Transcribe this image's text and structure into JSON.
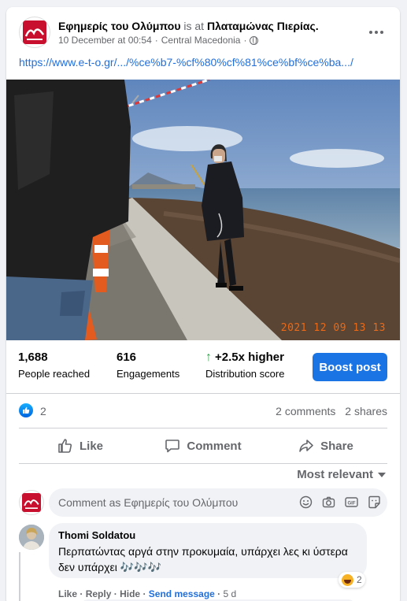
{
  "post": {
    "page_name": "Εφημερίς του Ολύμπου",
    "is_at": "is at",
    "location": "Πλαταμώνας Πιερίας.",
    "timestamp": "10 December at 00:54",
    "separator": "·",
    "region": "Central Macedonia",
    "privacy_icon": "globe-icon",
    "link": "https://www.e-t-o.gr/.../%ce%b7-%cf%80%cf%81%ce%bf%ce%ba.../",
    "photo_stamp": "2021 12 09 13 13"
  },
  "insights": {
    "reached_value": "1,688",
    "reached_label": "People reached",
    "engagements_value": "616",
    "engagements_label": "Engagements",
    "distribution_value": "+2.5x higher",
    "distribution_label": "Distribution score",
    "boost_label": "Boost post"
  },
  "reactions": {
    "count": "2",
    "comments": "2 comments",
    "shares": "2 shares"
  },
  "actions": {
    "like": "Like",
    "comment": "Comment",
    "share": "Share"
  },
  "sort": {
    "label": "Most relevant"
  },
  "composer": {
    "placeholder": "Comment as Εφημερίς του Ολύμπου"
  },
  "comment": {
    "author": "Thomi Soldatou",
    "text": "Περπατώντας αργά στην προκυμαία, υπάρχει λες κι ύστερα δεν υπάρχει 🎶🎶🎶",
    "reaction_count": "2",
    "like": "Like",
    "reply": "Reply",
    "hide": "Hide",
    "send": "Send message",
    "time": "5 d",
    "dot": "·"
  },
  "colors": {
    "accent": "#1b74e4",
    "link": "#216fdb",
    "brand_red": "#c8102e",
    "positive": "#31a24c"
  }
}
